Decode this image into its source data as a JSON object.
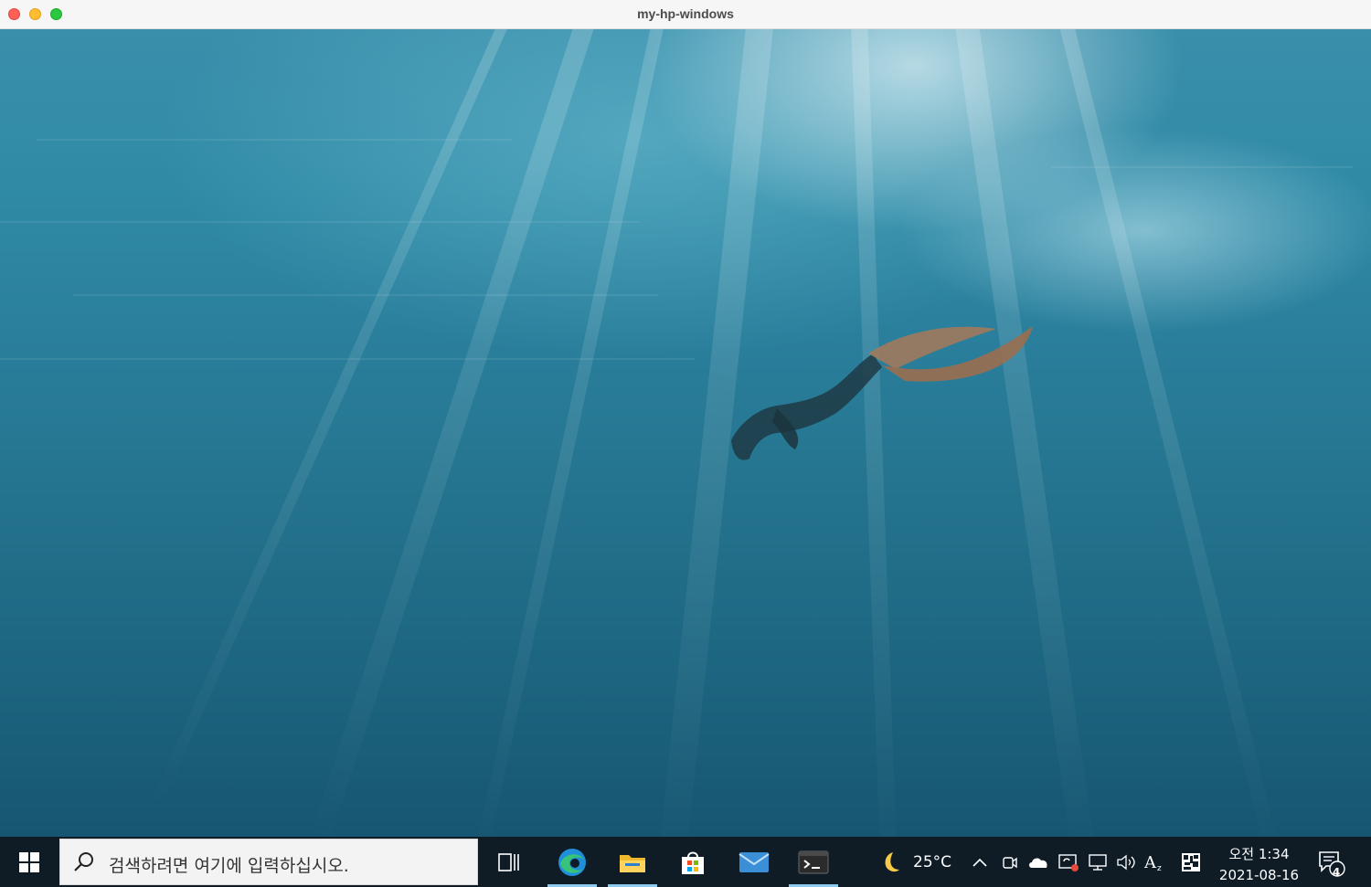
{
  "window": {
    "title": "my-hp-windows"
  },
  "taskbar": {
    "search_placeholder": "검색하려면 여기에 입력하십시오.",
    "apps": [
      "task-view",
      "edge",
      "file-explorer",
      "microsoft-store",
      "mail",
      "terminal"
    ],
    "weather": {
      "icon": "moon-icon",
      "temperature": "25°C"
    },
    "tray_icons": [
      "chevron-up-icon",
      "meet-now-icon",
      "onedrive-cloud-icon",
      "security-icon",
      "network-icon",
      "volume-icon",
      "ime-mode-icon",
      "ime-pad-icon"
    ],
    "clock": {
      "time": "오전 1:34",
      "date": "2021-08-16"
    },
    "notifications": {
      "count": "4"
    }
  },
  "colors": {
    "taskbar_bg": "#0f1c26",
    "active_indicator": "#8ec9ee",
    "water": "#2a7f9c"
  }
}
